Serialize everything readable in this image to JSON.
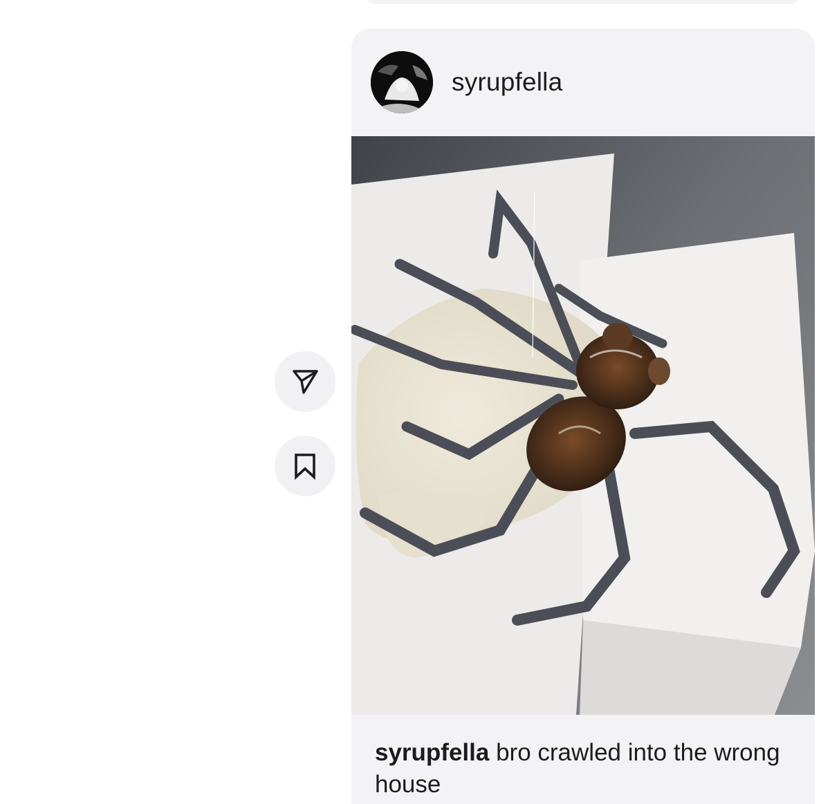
{
  "post": {
    "username": "syrupfella",
    "caption_user": "syrupfella",
    "caption_text": " bro crawled into the wrong house"
  },
  "actions": {
    "share_icon": "send-icon",
    "save_icon": "bookmark-icon"
  },
  "colors": {
    "card_background": "#f3f3f5",
    "text": "#1c1c1e"
  }
}
